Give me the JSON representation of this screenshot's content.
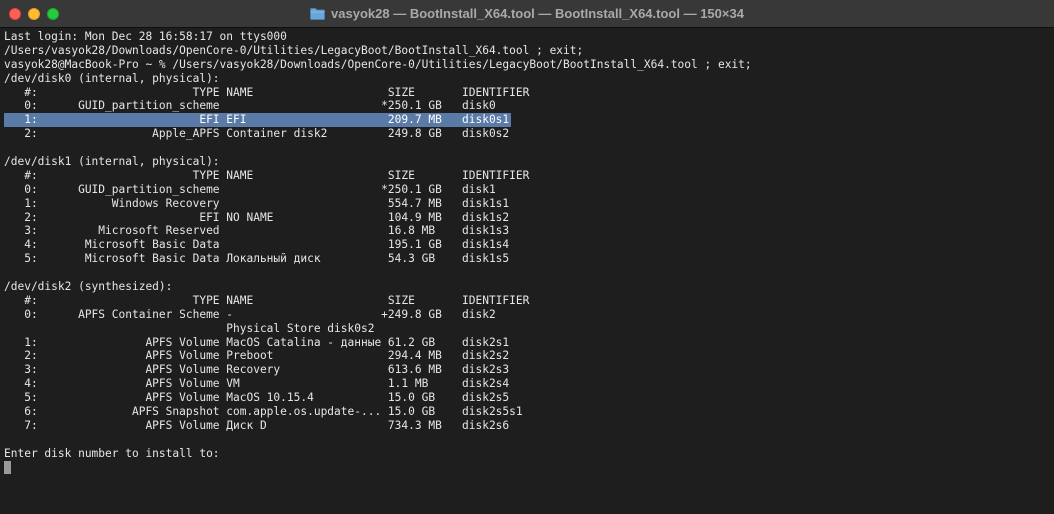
{
  "window": {
    "title": "vasyok28 — BootInstall_X64.tool — BootInstall_X64.tool — 150×34",
    "title_icon": "folder-icon",
    "traffic_lights": {
      "close": "#fe5f57",
      "minimize": "#febc2e",
      "zoom": "#28c840"
    }
  },
  "colors": {
    "background": "#1e1e1e",
    "text": "#e6e6e6",
    "selection": "#5a7aa8",
    "cursor": "#9a9a9a"
  },
  "terminal": {
    "lines": [
      "Last login: Mon Dec 28 16:58:17 on ttys000",
      "/Users/vasyok28/Downloads/OpenCore-0/Utilities/LegacyBoot/BootInstall_X64.tool ; exit;",
      "vasyok28@MacBook-Pro ~ % /Users/vasyok28/Downloads/OpenCore-0/Utilities/LegacyBoot/BootInstall_X64.tool ; exit;",
      "/dev/disk0 (internal, physical):",
      "   #:                       TYPE NAME                    SIZE       IDENTIFIER",
      "   0:      GUID_partition_scheme                        *250.1 GB   disk0",
      "   1:                        EFI EFI                     209.7 MB   disk0s1",
      "   2:                 Apple_APFS Container disk2         249.8 GB   disk0s2",
      "",
      "/dev/disk1 (internal, physical):",
      "   #:                       TYPE NAME                    SIZE       IDENTIFIER",
      "   0:      GUID_partition_scheme                        *250.1 GB   disk1",
      "   1:           Windows Recovery                         554.7 MB   disk1s1",
      "   2:                        EFI NO NAME                 104.9 MB   disk1s2",
      "   3:         Microsoft Reserved                         16.8 MB    disk1s3",
      "   4:       Microsoft Basic Data                         195.1 GB   disk1s4",
      "   5:       Microsoft Basic Data Локальный диск          54.3 GB    disk1s5",
      "",
      "/dev/disk2 (synthesized):",
      "   #:                       TYPE NAME                    SIZE       IDENTIFIER",
      "   0:      APFS Container Scheme -                      +249.8 GB   disk2",
      "                                 Physical Store disk0s2",
      "   1:                APFS Volume MacOS Catalina - данные 61.2 GB    disk2s1",
      "   2:                APFS Volume Preboot                 294.4 MB   disk2s2",
      "   3:                APFS Volume Recovery                613.6 MB   disk2s3",
      "   4:                APFS Volume VM                      1.1 MB     disk2s4",
      "   5:                APFS Volume MacOS 10.15.4           15.0 GB    disk2s5",
      "   6:              APFS Snapshot com.apple.os.update-... 15.0 GB    disk2s5s1",
      "   7:                APFS Volume Диск D                  734.3 MB   disk2s6",
      "",
      "Enter disk number to install to:"
    ],
    "selected_line_index": 6
  }
}
